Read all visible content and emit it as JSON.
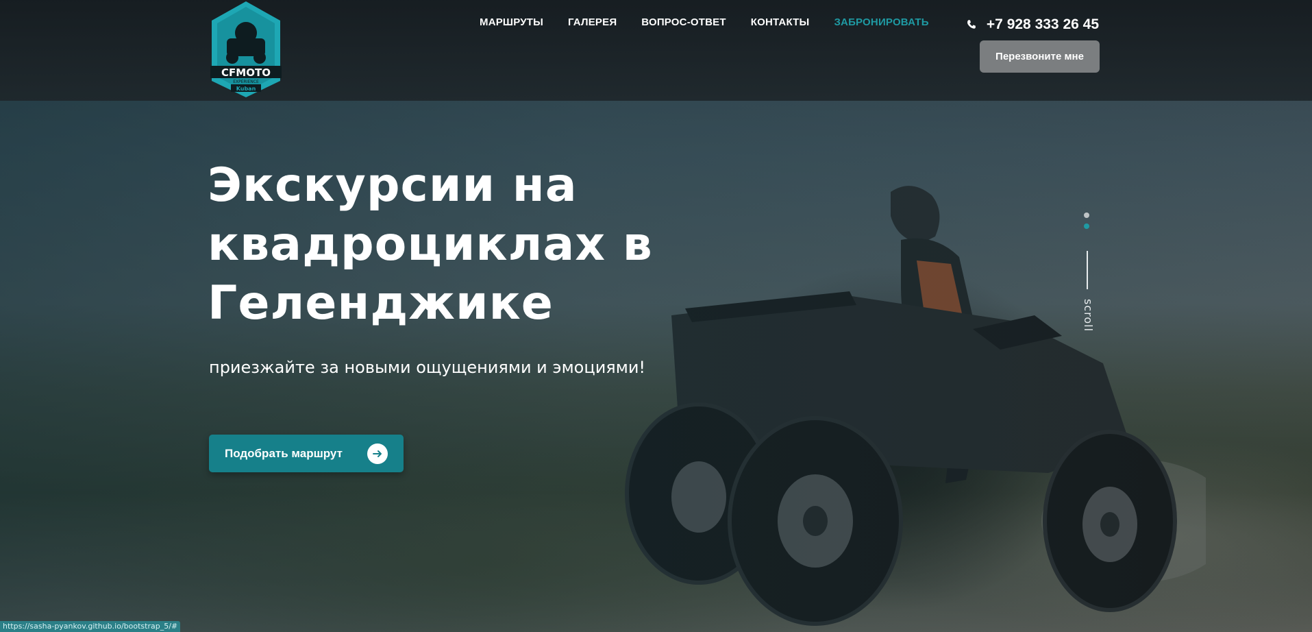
{
  "brand": {
    "logo_text": "CFMOTO",
    "logo_sub": "EXPERIENCE",
    "logo_region": "Kuban",
    "accent_color": "#1f9aa3"
  },
  "nav": {
    "items": [
      {
        "label": "МАРШРУТЫ"
      },
      {
        "label": "ГАЛЕРЕЯ"
      },
      {
        "label": "ВОПРОС-ОТВЕТ"
      },
      {
        "label": "КОНТАКТЫ"
      },
      {
        "label": "ЗАБРОНИРОВАТЬ"
      }
    ]
  },
  "contact": {
    "phone": "+7 928 333 26 45",
    "callback_label": "Перезвоните мне",
    "icon": "phone-icon"
  },
  "hero": {
    "title": "Экскурсии на квадроциклах в Геленджике",
    "subtitle": "приезжайте за новыми ощущениями и эмоциями!",
    "cta_label": "Подобрать маршрут",
    "cta_icon": "arrow-right-icon"
  },
  "scroll": {
    "label": "scroll",
    "slides_total": 2,
    "active_slide": 2
  },
  "status_bar": {
    "url": "https://sasha-pyankov.github.io/bootstrap_5/#"
  }
}
